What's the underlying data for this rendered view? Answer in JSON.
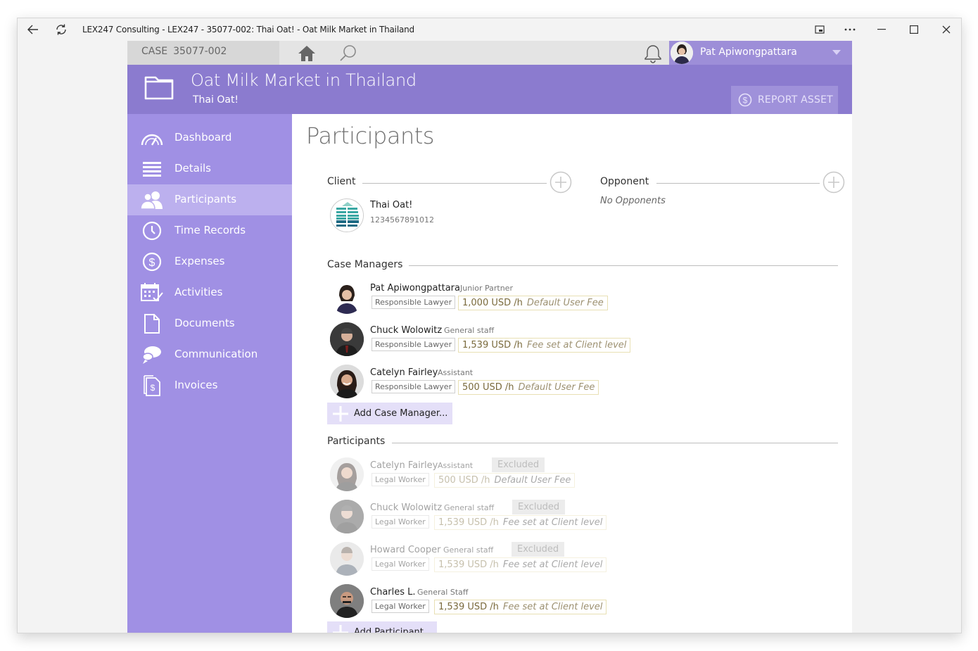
{
  "window": {
    "title": "LEX247 Consulting - LEX247 - 35077-002: Thai Oat! - Oat Milk Market in Thailand"
  },
  "topbar": {
    "case_label": "CASE",
    "case_number": "35077-002",
    "user_name": "Pat Apiwongpattara"
  },
  "header": {
    "title": "Oat Milk Market in Thailand",
    "subtitle": "Thai Oat!",
    "report_asset": "REPORT ASSET"
  },
  "sidebar": {
    "items": [
      {
        "label": "Dashboard",
        "icon": "gauge-icon"
      },
      {
        "label": "Details",
        "icon": "list-icon"
      },
      {
        "label": "Participants",
        "icon": "people-icon",
        "active": true
      },
      {
        "label": "Time Records",
        "icon": "clock-icon"
      },
      {
        "label": "Expenses",
        "icon": "dollar-icon"
      },
      {
        "label": "Activities",
        "icon": "calendar-icon"
      },
      {
        "label": "Documents",
        "icon": "document-icon"
      },
      {
        "label": "Communication",
        "icon": "chat-icon"
      },
      {
        "label": "Invoices",
        "icon": "invoice-icon"
      }
    ]
  },
  "main": {
    "page_title": "Participants",
    "client": {
      "label": "Client",
      "name": "Thai Oat!",
      "number": "1234567891012"
    },
    "opponent": {
      "label": "Opponent",
      "empty_text": "No Opponents"
    },
    "case_managers": {
      "label": "Case Managers",
      "add_label": "Add Case Manager...",
      "rows": [
        {
          "name": "Pat Apiwongpattara",
          "title": "Junior Partner",
          "role": "Responsible Lawyer",
          "fee": "1,000 USD /h",
          "fee_note": "Default User Fee"
        },
        {
          "name": "Chuck Wolowitz",
          "title": "General staff",
          "role": "Responsible Lawyer",
          "fee": "1,539 USD /h",
          "fee_note": "Fee set at Client level"
        },
        {
          "name": "Catelyn Fairley",
          "title": "Assistant",
          "role": "Responsible Lawyer",
          "fee": "500 USD /h",
          "fee_note": "Default User Fee"
        }
      ]
    },
    "participants": {
      "label": "Participants",
      "add_label": "Add Participant...",
      "excluded_label": "Excluded",
      "rows": [
        {
          "name": "Catelyn Fairley",
          "title": "Assistant",
          "role": "Legal Worker",
          "fee": "500 USD /h",
          "fee_note": "Default User Fee",
          "excluded": true
        },
        {
          "name": "Chuck Wolowitz",
          "title": "General staff",
          "role": "Legal Worker",
          "fee": "1,539 USD /h",
          "fee_note": "Fee set at Client level",
          "excluded": true
        },
        {
          "name": "Howard Cooper",
          "title": "General staff",
          "role": "Legal Worker",
          "fee": "1,539 USD /h",
          "fee_note": "Fee set at Client level",
          "excluded": true
        },
        {
          "name": "Charles L.",
          "title": "General Staff",
          "role": "Legal Worker",
          "fee": "1,539 USD /h",
          "fee_note": "Fee set at Client level",
          "excluded": false
        }
      ]
    }
  },
  "colors": {
    "sidebar": "#a090e4",
    "header": "#8b7bcf",
    "active_item": "#bcb0ee",
    "add_button": "#e4dff8"
  }
}
